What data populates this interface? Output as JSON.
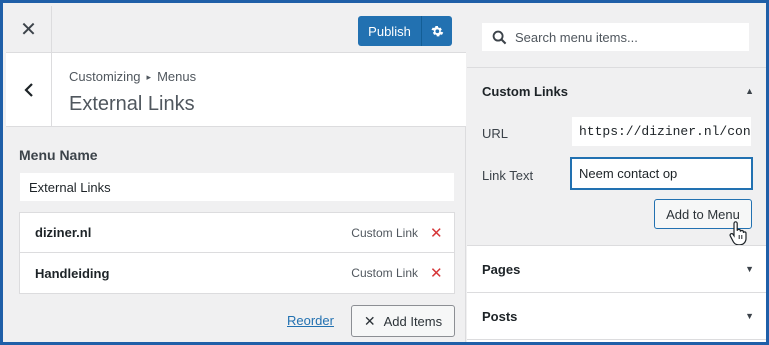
{
  "toolbar": {
    "close_glyph": "✕",
    "publish_label": "Publish"
  },
  "header": {
    "breadcrumb_root": "Customizing",
    "breadcrumb_sep": "▸",
    "breadcrumb_current": "Menus",
    "title": "External Links"
  },
  "menu": {
    "name_label": "Menu Name",
    "name_value": "External Links",
    "items": [
      {
        "title": "diziner.nl",
        "type": "Custom Link"
      },
      {
        "title": "Handleiding",
        "type": "Custom Link"
      }
    ],
    "reorder_label": "Reorder",
    "add_items_label": "Add Items"
  },
  "right_panel": {
    "search_placeholder": "Search menu items...",
    "custom_links": {
      "title": "Custom Links",
      "url_label": "URL",
      "url_value": "https://diziner.nl/cont",
      "link_text_label": "Link Text",
      "link_text_value": "Neem contact op",
      "add_button_label": "Add to Menu"
    },
    "sections": [
      {
        "title": "Pages"
      },
      {
        "title": "Posts"
      }
    ]
  },
  "colors": {
    "accent": "#2271b1",
    "frame_border": "#1f5fa8",
    "remove": "#d63638",
    "panel_bg": "#f0f0f1"
  },
  "icons": [
    "close-icon",
    "gear-icon",
    "chevron-left-icon",
    "remove-icon",
    "search-icon",
    "caret-up-icon",
    "caret-down-icon",
    "hand-pointer-icon"
  ]
}
